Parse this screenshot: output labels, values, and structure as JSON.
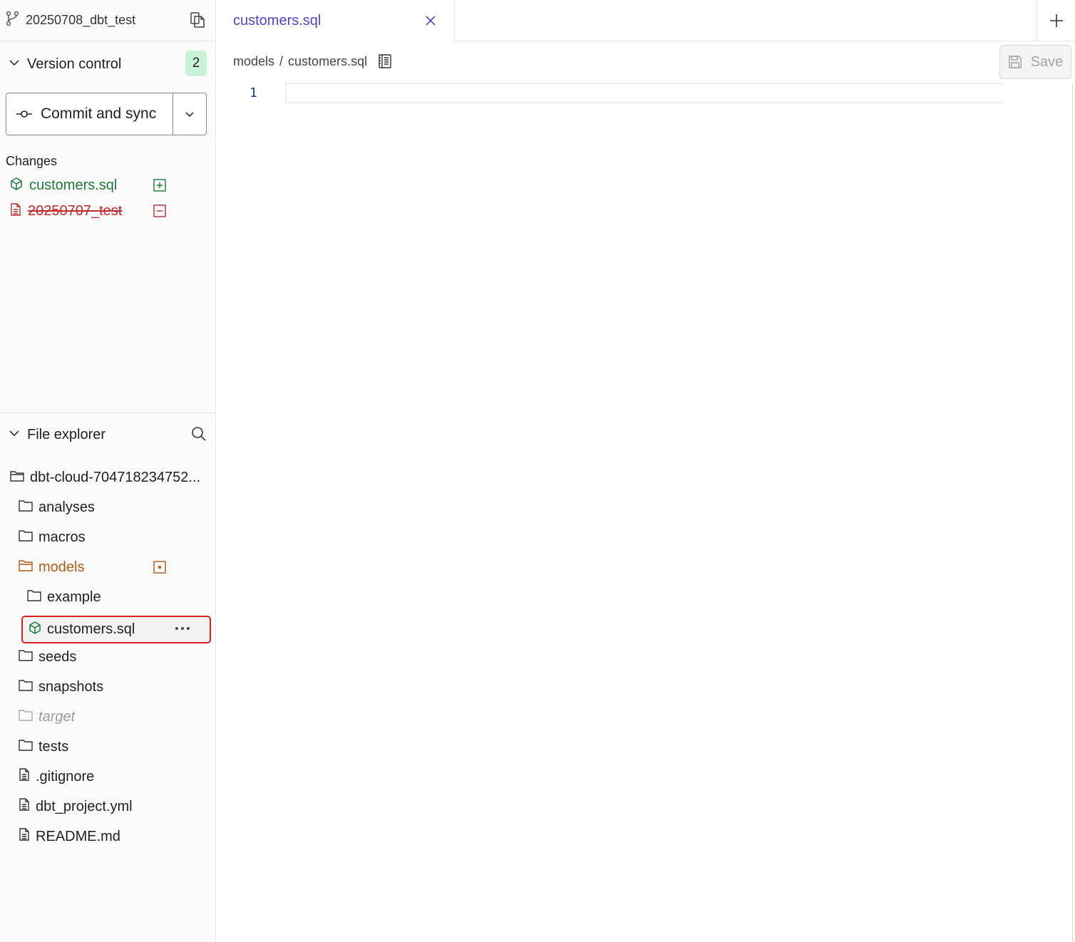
{
  "sidebar": {
    "branch_name": "20250708_dbt_test",
    "version_control": {
      "title": "Version control",
      "badge_count": "2",
      "commit_label": "Commit and sync",
      "changes_label": "Changes",
      "changes": [
        {
          "name": "customers.sql",
          "status": "added",
          "color": "#1d7a3a"
        },
        {
          "name": "20250707_test",
          "status": "deleted",
          "color": "#c62828"
        }
      ]
    },
    "file_explorer": {
      "title": "File explorer",
      "root": "dbt-cloud-704718234752...",
      "items": [
        {
          "name": "analyses",
          "type": "folder"
        },
        {
          "name": "macros",
          "type": "folder"
        },
        {
          "name": "models",
          "type": "folder-open",
          "color": "#b35a16"
        },
        {
          "name": "example",
          "type": "folder"
        },
        {
          "name": "customers.sql",
          "type": "model"
        },
        {
          "name": "seeds",
          "type": "folder"
        },
        {
          "name": "snapshots",
          "type": "folder"
        },
        {
          "name": "target",
          "type": "folder-ignored"
        },
        {
          "name": "tests",
          "type": "folder"
        },
        {
          "name": ".gitignore",
          "type": "file"
        },
        {
          "name": "dbt_project.yml",
          "type": "file"
        },
        {
          "name": "README.md",
          "type": "file"
        }
      ]
    }
  },
  "editor": {
    "tab_label": "customers.sql",
    "breadcrumb": {
      "folder": "models",
      "separator": "/",
      "file": "customers.sql"
    },
    "save_label": "Save",
    "line_numbers": [
      "1"
    ],
    "accent": "#5a3fd6"
  }
}
